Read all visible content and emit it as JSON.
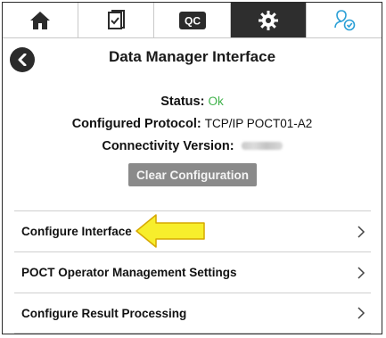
{
  "tabs": [
    {
      "icon": "home-icon",
      "active": false
    },
    {
      "icon": "clipboard-check-icon",
      "active": false
    },
    {
      "icon": "qc-icon",
      "label": "QC",
      "active": false
    },
    {
      "icon": "gear-icon",
      "active": true
    },
    {
      "icon": "user-check-icon",
      "active": false
    }
  ],
  "header": {
    "back_icon": "chevron-left-icon",
    "title": "Data Manager Interface"
  },
  "info": {
    "status_label": "Status:",
    "status_value": "Ok",
    "status_color": "#3fb24a",
    "protocol_label": "Configured Protocol:",
    "protocol_value": "TCP/IP POCT01-A2",
    "connectivity_label": "Connectivity Version:"
  },
  "clear_button": {
    "label": "Clear Configuration"
  },
  "menu": {
    "items": [
      {
        "label": "Configure Interface"
      },
      {
        "label": "POCT Operator Management Settings"
      },
      {
        "label": "Configure Result Processing"
      }
    ]
  },
  "annotation": {
    "arrow_color": "#f7ee2c",
    "arrow_outline": "#d6a800"
  }
}
